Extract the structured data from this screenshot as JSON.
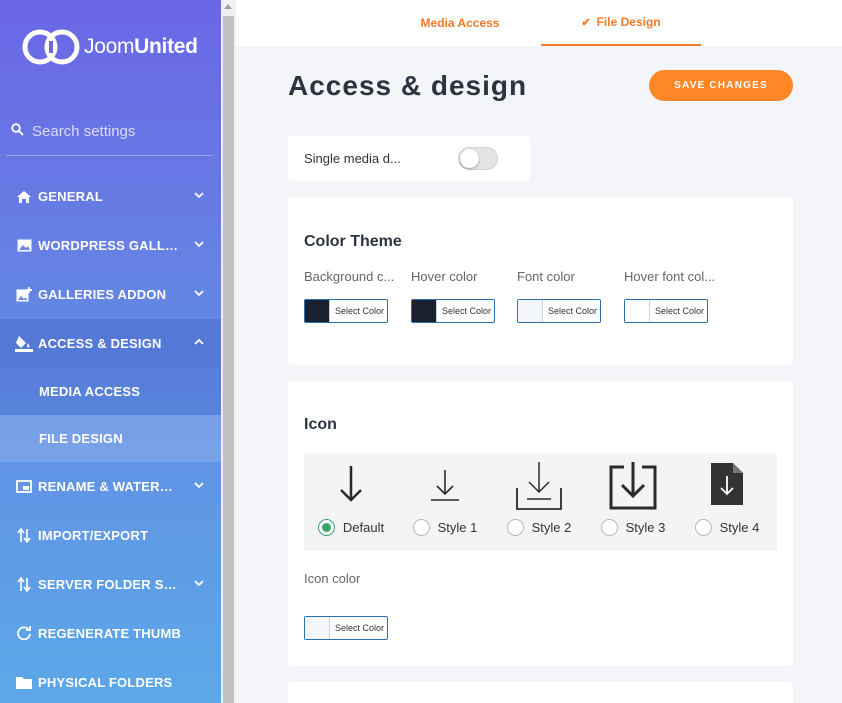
{
  "brand": {
    "name_light": "Joom",
    "name_bold": "United"
  },
  "search": {
    "placeholder": "Search settings"
  },
  "sidebar": {
    "items": [
      {
        "label": "GENERAL"
      },
      {
        "label": "WORDPRESS GALLERY"
      },
      {
        "label": "GALLERIES ADDON"
      },
      {
        "label": "ACCESS & DESIGN"
      },
      {
        "label": "RENAME & WATERMARK"
      },
      {
        "label": "IMPORT/EXPORT"
      },
      {
        "label": "SERVER FOLDER SYNC"
      },
      {
        "label": "REGENERATE THUMB"
      },
      {
        "label": "PHYSICAL FOLDERS"
      }
    ],
    "submenu": [
      {
        "label": "MEDIA ACCESS"
      },
      {
        "label": "FILE DESIGN"
      }
    ]
  },
  "tabs": [
    {
      "label": "Media Access"
    },
    {
      "label": "File Design",
      "check": "✔"
    }
  ],
  "page": {
    "title": "Access & design",
    "save_label": "SAVE CHANGES"
  },
  "toggle": {
    "label": "Single media d...",
    "on": false
  },
  "color_theme": {
    "title": "Color Theme",
    "fields": [
      {
        "label": "Background c...",
        "swatch": "#1b2031",
        "button": "Select Color"
      },
      {
        "label": "Hover color",
        "swatch": "#1b2031",
        "button": "Select Color"
      },
      {
        "label": "Font color",
        "swatch": "#f3f5f9",
        "button": "Select Color"
      },
      {
        "label": "Hover font col...",
        "swatch": "#ffffff",
        "button": "Select Color"
      }
    ]
  },
  "icon_section": {
    "title": "Icon",
    "options": [
      {
        "label": "Default",
        "selected": true
      },
      {
        "label": "Style 1",
        "selected": false
      },
      {
        "label": "Style 2",
        "selected": false
      },
      {
        "label": "Style 3",
        "selected": false
      },
      {
        "label": "Style 4",
        "selected": false
      }
    ],
    "color_label": "Icon color",
    "color_swatch": "#f3f5f9",
    "color_button": "Select Color"
  },
  "colors": {
    "accent": "#ff8726",
    "tab_text": "#f07a26",
    "radio_on": "#3aa36a"
  }
}
